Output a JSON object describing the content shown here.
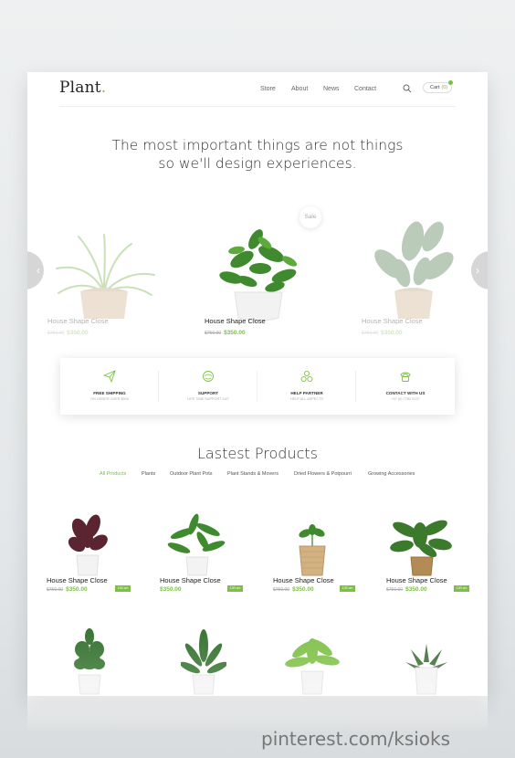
{
  "header": {
    "logo": "Plant",
    "logo_dot": ".",
    "nav": [
      "Store",
      "About",
      "News",
      "Contact"
    ],
    "cart_label": "Cart",
    "cart_count": "(0)"
  },
  "hero": {
    "line1": "The most important things are not things",
    "line2": "so we'll design experiences."
  },
  "slider": {
    "sale_badge": "Sale",
    "items": [
      {
        "name": "House Shape Close",
        "old_price": "$750.00",
        "price": "$350.00"
      },
      {
        "name": "House Shape Close",
        "old_price": "$750.00",
        "price": "$350.00"
      },
      {
        "name": "House Shape Close",
        "old_price": "$750.00",
        "price": "$350.00"
      }
    ],
    "prev_arrow": "‹",
    "next_arrow": "›"
  },
  "features": [
    {
      "title": "FREE SHIPPING",
      "subtitle": "ON ORDER OVER $300",
      "icon": "paper-plane-icon"
    },
    {
      "title": "SUPPORT",
      "subtitle": "LIFE TIME SUPPORT 24/7",
      "icon": "support-icon"
    },
    {
      "title": "HELP PARTNER",
      "subtitle": "HELP ALL ASPECTS",
      "icon": "partner-icon"
    },
    {
      "title": "CONTACT WITH US",
      "subtitle": "+07 (0) 7782 9137",
      "icon": "phone-icon"
    }
  ],
  "latest": {
    "title": "Lastest Products",
    "categories": [
      "All Products",
      "Plants",
      "Outdoor Plant Pots",
      "Plant Stands & Movers",
      "Dried Flowers & Potpourri",
      "Growing Accessories"
    ],
    "products": [
      {
        "name": "House Shape Close",
        "old_price": "$750.00",
        "price": "$350.00",
        "badge": "130 cm"
      },
      {
        "name": "House Shape Close",
        "old_price": "",
        "price": "$350.00",
        "badge": "130 cm"
      },
      {
        "name": "House Shape Close",
        "old_price": "$750.00",
        "price": "$350.00",
        "badge": "130 cm"
      },
      {
        "name": "House Shape Close",
        "old_price": "$750.00",
        "price": "$350.00",
        "badge": "130 cm"
      }
    ]
  },
  "colors": {
    "accent": "#7bc043"
  },
  "watermark": "pinterest.com/ksioks"
}
